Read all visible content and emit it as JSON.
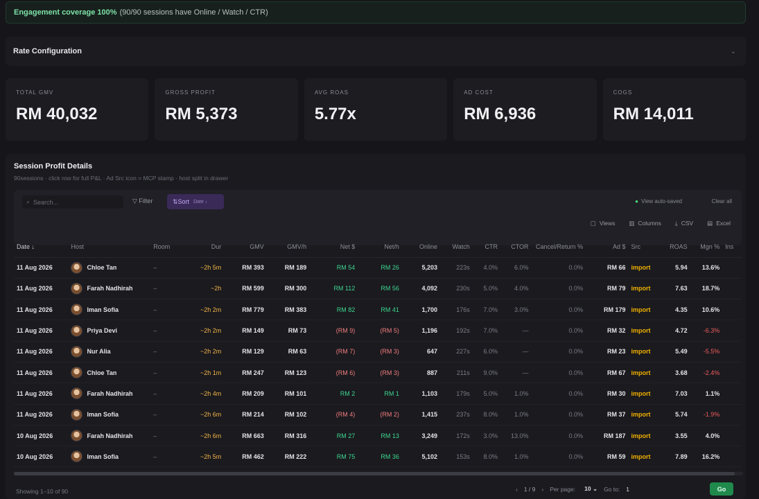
{
  "banner": {
    "strong": "Engagement coverage 100%",
    "rest": "(90/90 sessions have Online / Watch / CTR)"
  },
  "rate_config": {
    "title": "Rate Configuration",
    "chevron_icon": "chevron-down-icon"
  },
  "kpis": [
    {
      "label": "TOTAL GMV",
      "value": "RM 40,032"
    },
    {
      "label": "GROSS PROFIT",
      "value": "RM 5,373"
    },
    {
      "label": "AVG ROAS",
      "value": "5.77x"
    },
    {
      "label": "AD COST",
      "value": "RM 6,936"
    },
    {
      "label": "COGS",
      "value": "RM 14,011"
    }
  ],
  "panel": {
    "title": "Session Profit Details",
    "subtitle": "90sessions · click row for full P&L · Ad Src icon = MCP stamp · host split in drawer"
  },
  "toolbar": {
    "search_placeholder": "Search...",
    "filter_label": "Filter",
    "sort_label": "Sort",
    "sort_sub": "Date ↓",
    "autosave": "View auto-saved",
    "clear_all": "Clear all",
    "views": "Views",
    "columns": "Columns",
    "csv": "CSV",
    "excel": "Excel"
  },
  "table": {
    "headers": [
      "Date ↓",
      "Host",
      "Room",
      "Dur",
      "GMV",
      "GMV/h",
      "Net $",
      "Net/h",
      "Online",
      "Watch",
      "CTR",
      "CTOR",
      "Cancel/Return %",
      "Ad $",
      "Src",
      "ROAS",
      "Mgn %",
      "Ins"
    ],
    "rows": [
      {
        "date": "11 Aug 2026",
        "host": "Chloe Tan",
        "room": "–",
        "dur": "~2h 5m",
        "gmv": "RM 393",
        "gmvh": "RM 189",
        "net": "RM 54",
        "neth": "RM 26",
        "net_neg": false,
        "online": "5,203",
        "watch": "223s",
        "ctr": "4.0%",
        "ctor": "6.0%",
        "cancel": "0.0%",
        "ad": "RM 66",
        "src": "import",
        "roas": "5.94",
        "mgn": "13.6%",
        "mgn_neg": false
      },
      {
        "date": "11 Aug 2026",
        "host": "Farah Nadhirah",
        "room": "–",
        "dur": "~2h",
        "gmv": "RM 599",
        "gmvh": "RM 300",
        "net": "RM 112",
        "neth": "RM 56",
        "net_neg": false,
        "online": "4,092",
        "watch": "230s",
        "ctr": "5.0%",
        "ctor": "4.0%",
        "cancel": "0.0%",
        "ad": "RM 79",
        "src": "import",
        "roas": "7.63",
        "mgn": "18.7%",
        "mgn_neg": false
      },
      {
        "date": "11 Aug 2026",
        "host": "Iman Sofia",
        "room": "–",
        "dur": "~2h 2m",
        "gmv": "RM 779",
        "gmvh": "RM 383",
        "net": "RM 82",
        "neth": "RM 41",
        "net_neg": false,
        "online": "1,700",
        "watch": "176s",
        "ctr": "7.0%",
        "ctor": "3.0%",
        "cancel": "0.0%",
        "ad": "RM 179",
        "src": "import",
        "roas": "4.35",
        "mgn": "10.6%",
        "mgn_neg": false
      },
      {
        "date": "11 Aug 2026",
        "host": "Priya Devi",
        "room": "–",
        "dur": "~2h 2m",
        "gmv": "RM 149",
        "gmvh": "RM 73",
        "net": "(RM 9)",
        "neth": "(RM 5)",
        "net_neg": true,
        "online": "1,196",
        "watch": "192s",
        "ctr": "7.0%",
        "ctor": "—",
        "cancel": "0.0%",
        "ad": "RM 32",
        "src": "import",
        "roas": "4.72",
        "mgn": "-6.3%",
        "mgn_neg": true
      },
      {
        "date": "11 Aug 2026",
        "host": "Nur Alia",
        "room": "–",
        "dur": "~2h 2m",
        "gmv": "RM 129",
        "gmvh": "RM 63",
        "net": "(RM 7)",
        "neth": "(RM 3)",
        "net_neg": true,
        "online": "647",
        "watch": "227s",
        "ctr": "6.0%",
        "ctor": "—",
        "cancel": "0.0%",
        "ad": "RM 23",
        "src": "import",
        "roas": "5.49",
        "mgn": "-5.5%",
        "mgn_neg": true
      },
      {
        "date": "11 Aug 2026",
        "host": "Chloe Tan",
        "room": "–",
        "dur": "~2h 1m",
        "gmv": "RM 247",
        "gmvh": "RM 123",
        "net": "(RM 6)",
        "neth": "(RM 3)",
        "net_neg": true,
        "online": "887",
        "watch": "211s",
        "ctr": "9.0%",
        "ctor": "—",
        "cancel": "0.0%",
        "ad": "RM 67",
        "src": "import",
        "roas": "3.68",
        "mgn": "-2.4%",
        "mgn_neg": true
      },
      {
        "date": "11 Aug 2026",
        "host": "Farah Nadhirah",
        "room": "–",
        "dur": "~2h 4m",
        "gmv": "RM 209",
        "gmvh": "RM 101",
        "net": "RM 2",
        "neth": "RM 1",
        "net_neg": false,
        "online": "1,103",
        "watch": "179s",
        "ctr": "5.0%",
        "ctor": "1.0%",
        "cancel": "0.0%",
        "ad": "RM 30",
        "src": "import",
        "roas": "7.03",
        "mgn": "1.1%",
        "mgn_neg": false
      },
      {
        "date": "11 Aug 2026",
        "host": "Iman Sofia",
        "room": "–",
        "dur": "~2h 6m",
        "gmv": "RM 214",
        "gmvh": "RM 102",
        "net": "(RM 4)",
        "neth": "(RM 2)",
        "net_neg": true,
        "online": "1,415",
        "watch": "237s",
        "ctr": "8.0%",
        "ctor": "1.0%",
        "cancel": "0.0%",
        "ad": "RM 37",
        "src": "import",
        "roas": "5.74",
        "mgn": "-1.9%",
        "mgn_neg": true
      },
      {
        "date": "10 Aug 2026",
        "host": "Farah Nadhirah",
        "room": "–",
        "dur": "~2h 6m",
        "gmv": "RM 663",
        "gmvh": "RM 316",
        "net": "RM 27",
        "neth": "RM 13",
        "net_neg": false,
        "online": "3,249",
        "watch": "172s",
        "ctr": "3.0%",
        "ctor": "13.0%",
        "cancel": "0.0%",
        "ad": "RM 187",
        "src": "import",
        "roas": "3.55",
        "mgn": "4.0%",
        "mgn_neg": false
      },
      {
        "date": "10 Aug 2026",
        "host": "Iman Sofia",
        "room": "–",
        "dur": "~2h 5m",
        "gmv": "RM 462",
        "gmvh": "RM 222",
        "net": "RM 75",
        "neth": "RM 36",
        "net_neg": false,
        "online": "5,102",
        "watch": "153s",
        "ctr": "8.0%",
        "ctor": "1.0%",
        "cancel": "0.0%",
        "ad": "RM 59",
        "src": "import",
        "roas": "7.89",
        "mgn": "16.2%",
        "mgn_neg": false
      }
    ]
  },
  "footer": {
    "showing": "Showing 1–10 of 90",
    "page": "1 / 9",
    "per_page_label": "Per page:",
    "per_page_value": "10",
    "goto_label": "Go to:",
    "goto_value": "1",
    "go_button": "Go"
  },
  "colors": {
    "accent_purple": "#3a2a58",
    "green": "#3fd68f",
    "red": "#f07d7d",
    "amber": "#f2b347",
    "src_yellow": "#f0b000",
    "go_green": "#1f8a4c"
  }
}
